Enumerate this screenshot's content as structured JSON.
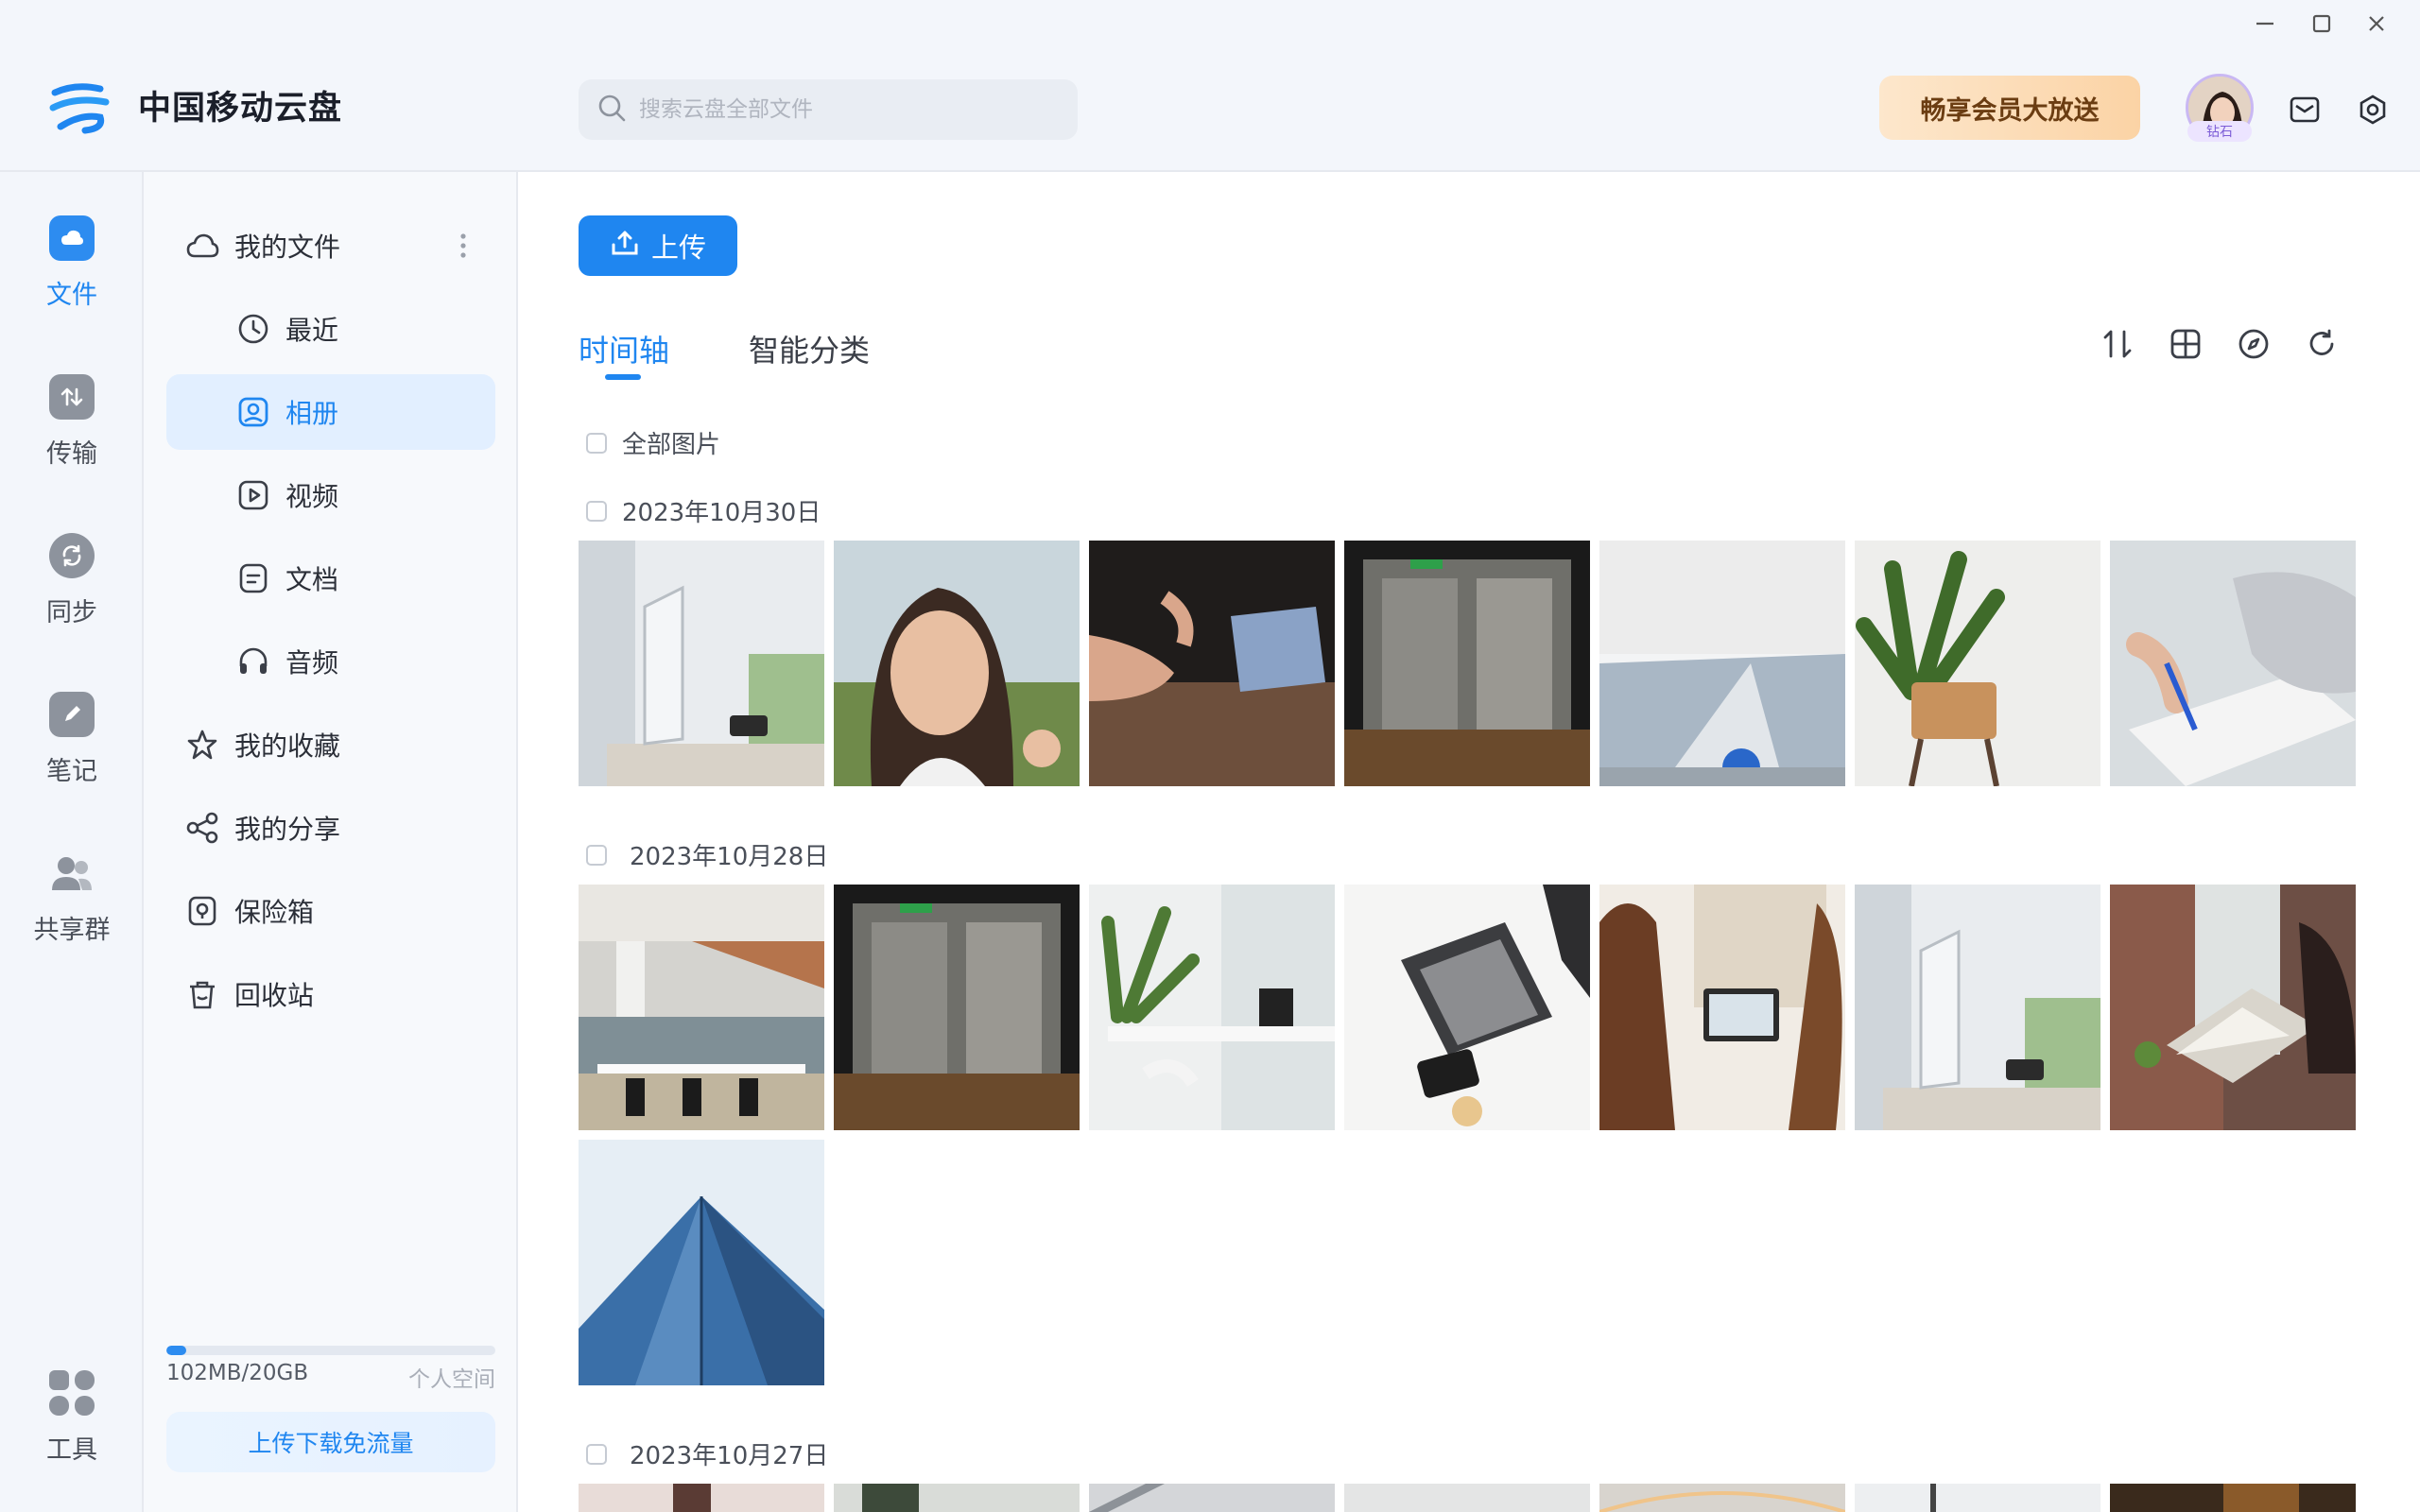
{
  "app": {
    "name": "中国移动云盘"
  },
  "search": {
    "placeholder": "搜索云盘全部文件"
  },
  "header": {
    "promo_label": "畅享会员大放送",
    "avatar_badge": "钻石"
  },
  "rail": {
    "items": [
      {
        "label": "文件",
        "icon": "cloud-icon"
      },
      {
        "label": "传输",
        "icon": "transfer-icon"
      },
      {
        "label": "同步",
        "icon": "sync-icon"
      },
      {
        "label": "笔记",
        "icon": "note-icon"
      },
      {
        "label": "共享群",
        "icon": "group-icon"
      }
    ],
    "tools_label": "工具"
  },
  "nav": {
    "items": [
      {
        "label": "我的文件",
        "icon": "cloud-outline-icon"
      },
      {
        "label": "最近",
        "icon": "clock-icon"
      },
      {
        "label": "相册",
        "icon": "album-icon"
      },
      {
        "label": "视频",
        "icon": "video-icon"
      },
      {
        "label": "文档",
        "icon": "document-icon"
      },
      {
        "label": "音频",
        "icon": "headphones-icon"
      },
      {
        "label": "我的收藏",
        "icon": "star-icon"
      },
      {
        "label": "我的分享",
        "icon": "share-icon"
      },
      {
        "label": "保险箱",
        "icon": "safe-icon"
      },
      {
        "label": "回收站",
        "icon": "trash-icon"
      }
    ],
    "active_index": 2
  },
  "storage": {
    "used_text": "102MB/20GB",
    "kind": "个人空间",
    "fill_ratio": 0.06,
    "flow_button": "上传下载免流量"
  },
  "main": {
    "upload_label": "上传",
    "tabs": [
      "时间轴",
      "智能分类"
    ],
    "all_photos_label": "全部图片",
    "groups": [
      {
        "date": "2023年10月30日",
        "photos": [
          "desk-monitor",
          "woman-portrait",
          "meeting-hands",
          "glass-office",
          "white-atrium",
          "palm-chair",
          "writing-notebook"
        ]
      },
      {
        "date": "2023年10月28日",
        "photos": [
          "open-office",
          "glass-office",
          "plants-window",
          "laptop-top-view",
          "women-laptop",
          "desk-monitor",
          "laptop-brick"
        ]
      },
      {
        "date": "2023年10月27日",
        "photos": [
          "p1",
          "p2",
          "p3",
          "p4",
          "p5",
          "p6",
          "p7"
        ]
      }
    ],
    "extra_photo_28": "building-glass"
  },
  "colors": {
    "accent": "#1f86f0",
    "rail_bg": "#f3f6fb",
    "nav_active_bg": "#e2efff"
  }
}
